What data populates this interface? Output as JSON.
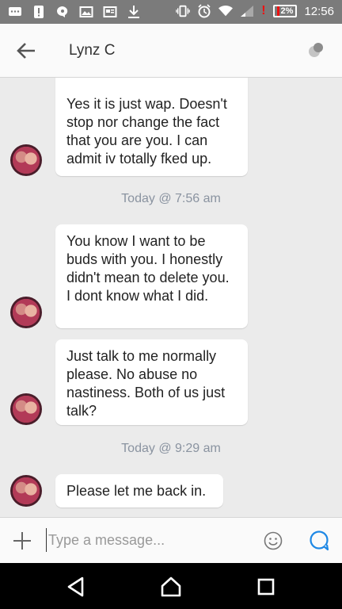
{
  "status_bar": {
    "battery": "2%",
    "time": "12:56"
  },
  "header": {
    "title": "Lynz C"
  },
  "messages": [
    {
      "text": "Yes it is just wap. Doesn't stop nor change the fact that you are you. I can admit iv totally fked up."
    },
    {
      "timestamp": "Today @ 7:56 am"
    },
    {
      "text": "You know I want to be buds with you. I honestly didn't mean to delete you. I dont know what I did."
    },
    {
      "text": "Just talk to me normally please. No abuse no nastiness. Both of us just talk?"
    },
    {
      "timestamp": "Today @ 9:29 am"
    },
    {
      "text": "Please let me back in."
    }
  ],
  "composer": {
    "placeholder": "Type a message..."
  },
  "colors": {
    "accent": "#1e88e5",
    "status_bar": "#7b7b7b",
    "chat_background": "#ebebeb"
  }
}
